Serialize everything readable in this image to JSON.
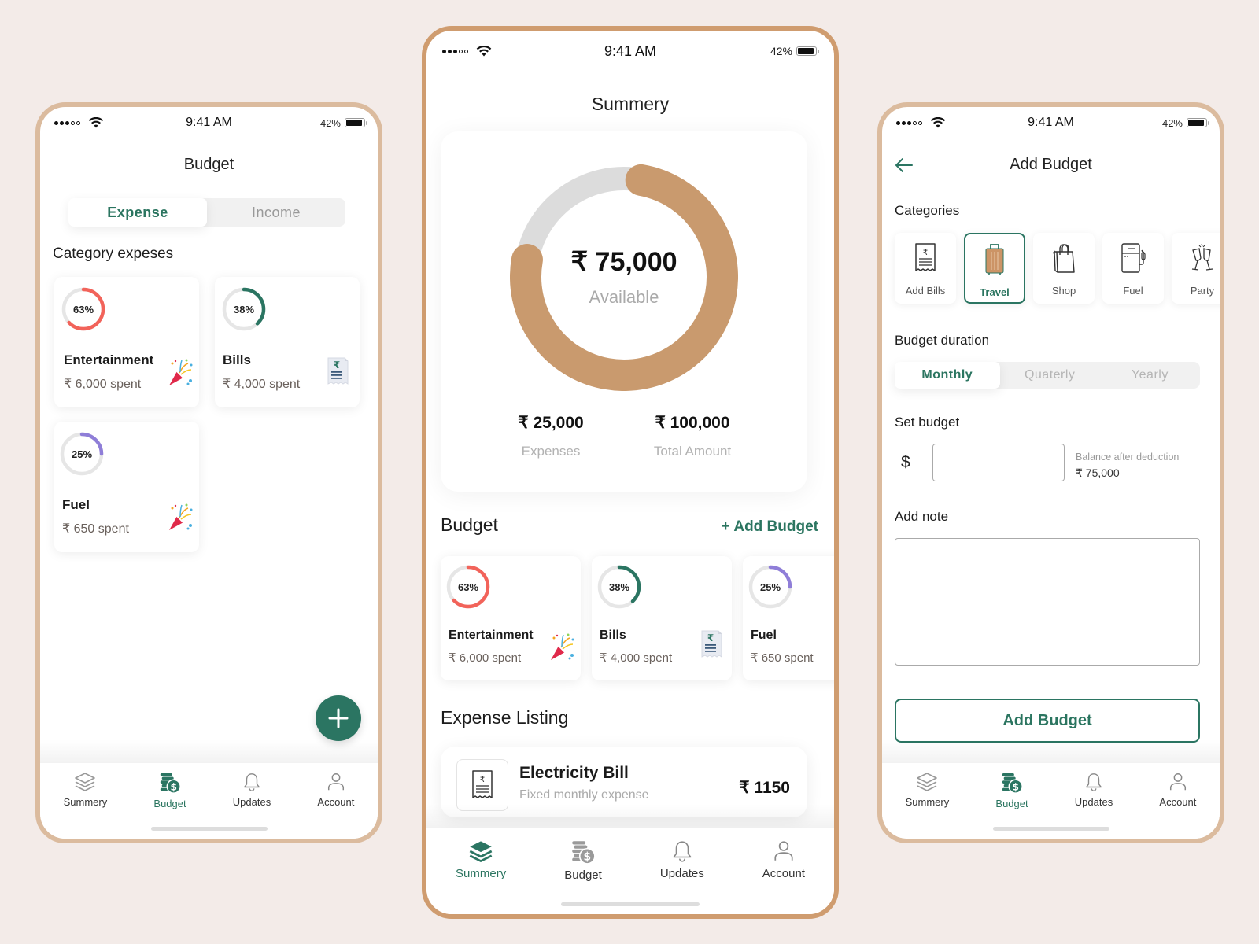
{
  "colors": {
    "background": "#f3ebe8",
    "accent_green": "#2b7562",
    "entertainment_ring": "#f2635a",
    "bills_ring": "#2b7562",
    "fuel_ring": "#8f7ed8",
    "donut_fill": "#c99a6e",
    "donut_track": "#dcdcdc"
  },
  "status_bar": {
    "time": "9:41 AM",
    "battery": "42%",
    "battery_fraction": 0.42
  },
  "budget_screen": {
    "title": "Budget",
    "tabs": [
      {
        "label": "Expense",
        "active": true
      },
      {
        "label": "Income",
        "active": false
      }
    ],
    "section_title": "Category expeses",
    "categories": [
      {
        "name": "Entertainment",
        "spent": "₹ 6,000 spent",
        "percent": 63,
        "percent_label": "63%",
        "icon": "party-popper-icon",
        "color": "#f2635a"
      },
      {
        "name": "Bills",
        "spent": "₹ 4,000 spent",
        "percent": 38,
        "percent_label": "38%",
        "icon": "receipt-icon",
        "color": "#2b7562"
      },
      {
        "name": "Fuel",
        "spent": "₹ 650 spent",
        "percent": 25,
        "percent_label": "25%",
        "icon": "party-popper-icon",
        "color": "#8f7ed8"
      }
    ],
    "fab_icon": "plus-icon"
  },
  "summary_screen": {
    "title": "Summery",
    "available_amount": "₹ 75,000",
    "available_label": "Available",
    "available_fraction": 0.75,
    "expenses_amount": "₹ 25,000",
    "expenses_label": "Expenses",
    "total_amount": "₹ 100,000",
    "total_label": "Total Amount",
    "budget_section_title": "Budget",
    "add_budget_link": "+ Add Budget",
    "budget_cards": [
      {
        "name": "Entertainment",
        "spent": "₹ 6,000 spent",
        "percent": 63,
        "percent_label": "63%",
        "icon": "party-popper-icon",
        "color": "#f2635a"
      },
      {
        "name": "Bills",
        "spent": "₹ 4,000 spent",
        "percent": 38,
        "percent_label": "38%",
        "icon": "receipt-icon",
        "color": "#2b7562"
      },
      {
        "name": "Fuel",
        "spent": "₹ 650 spent",
        "percent": 25,
        "percent_label": "25%",
        "icon": "",
        "color": "#8f7ed8"
      }
    ],
    "expense_section_title": "Expense Listing",
    "expenses": [
      {
        "title": "Electricity Bill",
        "subtitle": "Fixed monthly expense",
        "amount": "₹ 1150",
        "icon": "receipt-icon"
      }
    ]
  },
  "add_budget_screen": {
    "title": "Add Budget",
    "back_icon": "arrow-left-icon",
    "categories_label": "Categories",
    "categories": [
      {
        "label": "Add Bills",
        "icon": "receipt-icon",
        "selected": false
      },
      {
        "label": "Travel",
        "icon": "suitcase-icon",
        "selected": true
      },
      {
        "label": "Shop",
        "icon": "shopping-bag-icon",
        "selected": false
      },
      {
        "label": "Fuel",
        "icon": "fuel-pump-icon",
        "selected": false
      },
      {
        "label": "Party",
        "icon": "champagne-glasses-icon",
        "selected": false
      }
    ],
    "duration_label": "Budget duration",
    "durations": [
      {
        "label": "Monthly",
        "active": true
      },
      {
        "label": "Quaterly",
        "active": false
      },
      {
        "label": "Yearly",
        "active": false
      }
    ],
    "set_budget_label": "Set budget",
    "currency_symbol": "$",
    "budget_value": "",
    "balance_label": "Balance after deduction",
    "balance_value": "₹ 75,000",
    "note_label": "Add note",
    "note_value": "",
    "submit_label": "Add Budget"
  },
  "bottom_nav": {
    "items": [
      {
        "label": "Summery",
        "icon": "layers-icon"
      },
      {
        "label": "Budget",
        "icon": "coins-dollar-icon"
      },
      {
        "label": "Updates",
        "icon": "bell-icon"
      },
      {
        "label": "Account",
        "icon": "user-icon"
      }
    ],
    "active_left": "Budget",
    "active_center": "Summery",
    "active_right": "Budget"
  }
}
